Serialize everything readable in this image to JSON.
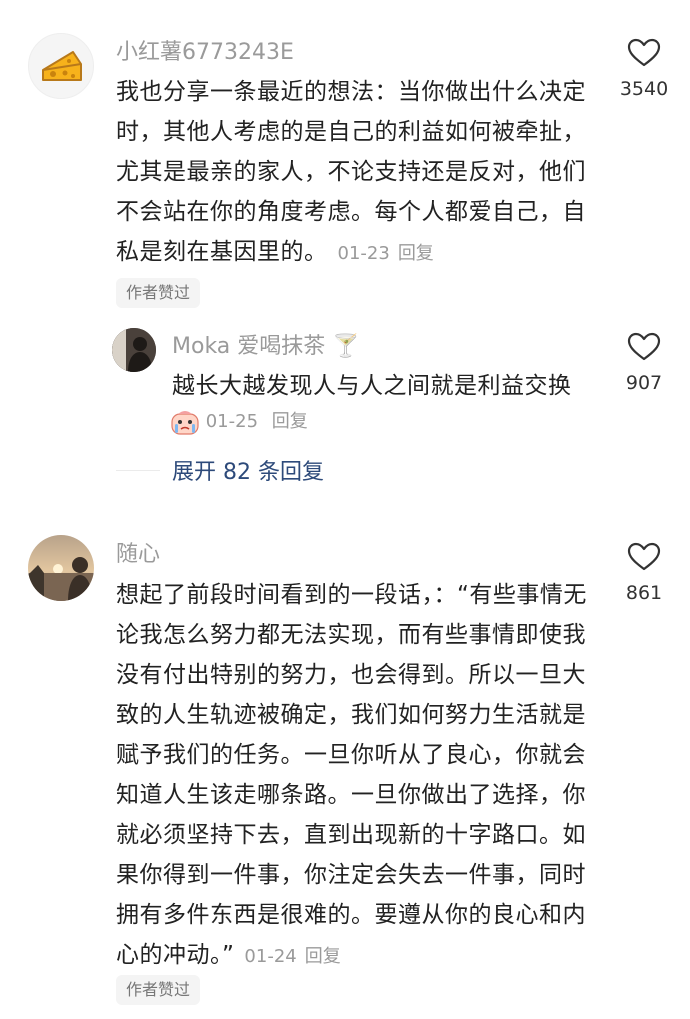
{
  "comments": [
    {
      "username": "小红薯6773243E",
      "text": "我也分享一条最近的想法：当你做出什么决定时，其他人考虑的是自己的利益如何被牵扯，尤其是最亲的家人，不论支持还是反对，他们不会站在你的角度考虑。每个人都爱自己，自私是刻在基因里的。",
      "date": "01-23",
      "reply_label": "回复",
      "badge": "作者赞过",
      "likes": "3540",
      "avatar_icon": "cheese-icon",
      "replies": [
        {
          "username": "Moka 爱喝抹茶",
          "username_emoji": "🍸",
          "text": "越长大越发现人与人之间就是利益交换",
          "sticker_icon": "crying-face-sticker-icon",
          "date": "01-25",
          "reply_label": "回复",
          "likes": "907"
        }
      ],
      "expand_label": "展开 82 条回复"
    },
    {
      "username": "随心",
      "text": "想起了前段时间看到的一段话，：“有些事情无论我怎么努力都无法实现，而有些事情即使我没有付出特别的努力，也会得到。所以一旦大致的人生轨迹被确定，我们如何努力生活就是赋予我们的任务。一旦你听从了良心，你就会知道人生该走哪条路。一旦你做出了选择，你就必须坚持下去，直到出现新的十字路口。如果你得到一件事，你注定会失去一件事，同时拥有多件东西是很难的。要遵从你的良心和内心的冲动。”",
      "date": "01-24",
      "reply_label": "回复",
      "badge": "作者赞过",
      "likes": "861",
      "avatar_icon": "sunset-photo-avatar"
    }
  ],
  "colors": {
    "text": "#222222",
    "muted": "#9a9a9a",
    "expand_link": "#2d4a7a",
    "badge_bg": "#f4f4f4"
  }
}
